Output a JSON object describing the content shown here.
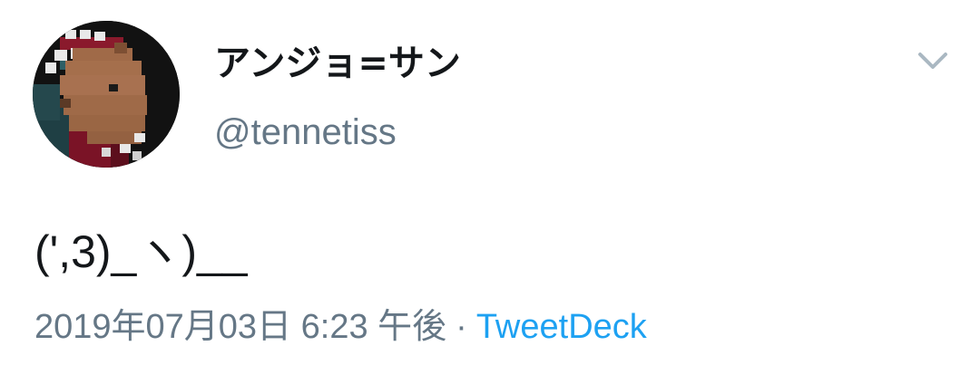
{
  "tweet": {
    "display_name": "アンジョ=サン",
    "handle": "@tennetiss",
    "text": "(',3)_ヽ)__",
    "timestamp": "2019年07月03日 6:23 午後",
    "separator": "·",
    "source": "TweetDeck"
  },
  "icons": {
    "caret": "chevron-down-icon",
    "avatar": "pixel-art-capybara-avatar"
  },
  "colors": {
    "primary_text": "#14171a",
    "secondary_text": "#657786",
    "link": "#1da1f2",
    "caret": "#aab8c2"
  }
}
